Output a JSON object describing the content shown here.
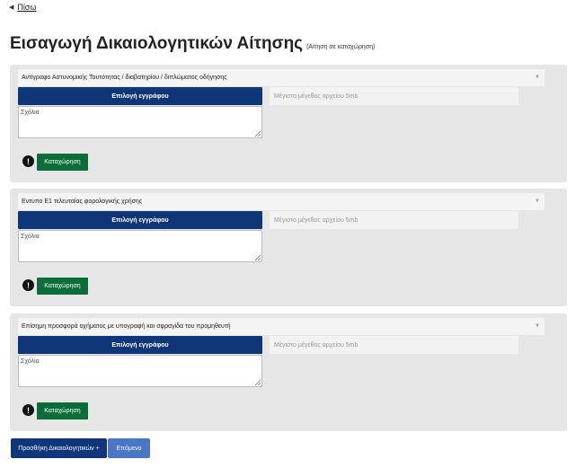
{
  "nav": {
    "back_label": "Πίσω"
  },
  "header": {
    "title": "Εισαγωγή Δικαιολογητικών Αίτησης",
    "subtitle": "(Αίτηση σε καταχώρηση)"
  },
  "sections": [
    {
      "document_type": "Αντίγραφο Αστυνομικής Ταυτότητας / διαβατηρίου / διπλώματος οδήγησης",
      "choose_label": "Επιλογή εγγράφου",
      "filesize_placeholder": "Μέγιστο μέγεθος αρχείου 5mb",
      "comments_placeholder": "Σχόλια",
      "save_label": "Καταχώρηση"
    },
    {
      "document_type": "Εντυπο Ε1 τελευταίας φορολογικής χρήσης",
      "choose_label": "Επιλογή εγγράφου",
      "filesize_placeholder": "Μέγιστο μέγεθος αρχείου 5mb",
      "comments_placeholder": "Σχόλια",
      "save_label": "Καταχώρηση"
    },
    {
      "document_type": "Επίσημη προσφορά οχήματος με υπογραφή και σφραγίδα του προμηθευτή",
      "choose_label": "Επιλογή εγγράφου",
      "filesize_placeholder": "Μέγιστο μέγεθος αρχείου 5mb",
      "comments_placeholder": "Σχόλια",
      "save_label": "Καταχώρηση"
    }
  ],
  "footer": {
    "add_documents_label": "Προσθήκη Δικαιολογητικών +",
    "next_label": "Επόμενο"
  }
}
